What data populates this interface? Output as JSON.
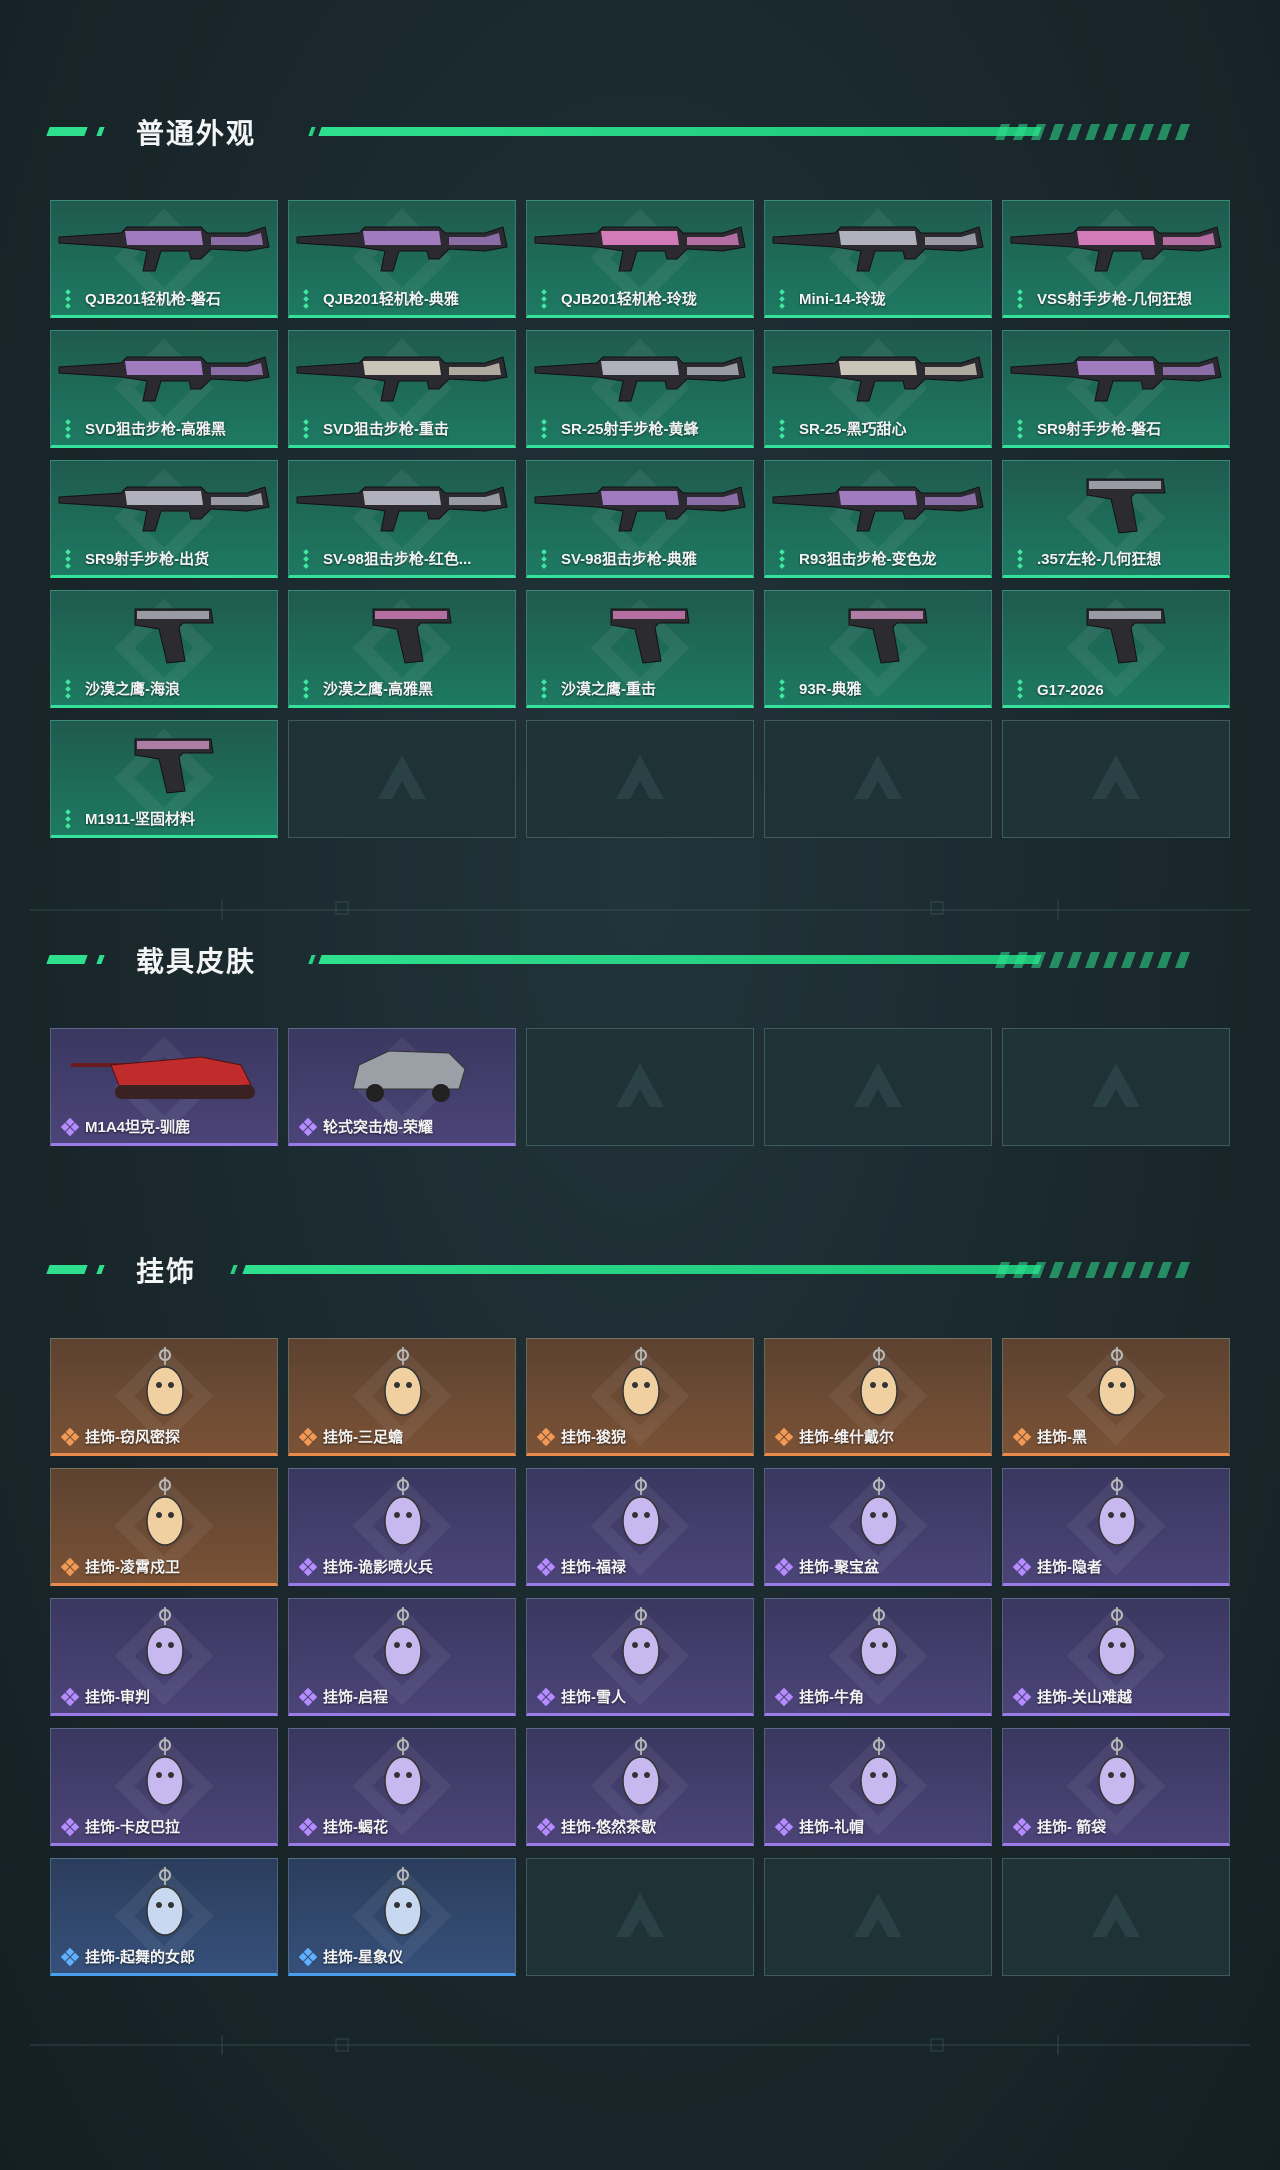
{
  "sections": {
    "skins": {
      "title": "普通外观",
      "items": [
        {
          "label": "QJB201轻机枪-磐石",
          "tier": "green",
          "icon": "light-machine-gun"
        },
        {
          "label": "QJB201轻机枪-典雅",
          "tier": "green",
          "icon": "light-machine-gun"
        },
        {
          "label": "QJB201轻机枪-玲珑",
          "tier": "green",
          "icon": "light-machine-gun"
        },
        {
          "label": "Mini-14-玲珑",
          "tier": "green",
          "icon": "rifle"
        },
        {
          "label": "VSS射手步枪-几何狂想",
          "tier": "green",
          "icon": "marksman-rifle"
        },
        {
          "label": "SVD狙击步枪-高雅黑",
          "tier": "green",
          "icon": "sniper-rifle"
        },
        {
          "label": "SVD狙击步枪-重击",
          "tier": "green",
          "icon": "sniper-rifle"
        },
        {
          "label": "SR-25射手步枪-黄蜂",
          "tier": "green",
          "icon": "marksman-rifle"
        },
        {
          "label": "SR-25-黑巧甜心",
          "tier": "green",
          "icon": "marksman-rifle"
        },
        {
          "label": "SR9射手步枪-磐石",
          "tier": "green",
          "icon": "marksman-rifle"
        },
        {
          "label": "SR9射手步枪-出货",
          "tier": "green",
          "icon": "marksman-rifle"
        },
        {
          "label": "SV-98狙击步枪-红色...",
          "tier": "green",
          "icon": "sniper-rifle"
        },
        {
          "label": "SV-98狙击步枪-典雅",
          "tier": "green",
          "icon": "sniper-rifle"
        },
        {
          "label": "R93狙击步枪-变色龙",
          "tier": "green",
          "icon": "sniper-rifle"
        },
        {
          "label": ".357左轮-几何狂想",
          "tier": "green",
          "icon": "revolver"
        },
        {
          "label": "沙漠之鹰-海浪",
          "tier": "green",
          "icon": "pistol"
        },
        {
          "label": "沙漠之鹰-高雅黑",
          "tier": "green",
          "icon": "pistol"
        },
        {
          "label": "沙漠之鹰-重击",
          "tier": "green",
          "icon": "pistol"
        },
        {
          "label": "93R-典雅",
          "tier": "green",
          "icon": "pistol"
        },
        {
          "label": "G17-2026",
          "tier": "green",
          "icon": "pistol"
        },
        {
          "label": "M1911-坚固材料",
          "tier": "green",
          "icon": "pistol"
        }
      ]
    },
    "vehicles": {
      "title": "载具皮肤",
      "items": [
        {
          "label": "M1A4坦克-驯鹿",
          "tier": "purple",
          "icon": "tank"
        },
        {
          "label": "轮式突击炮-荣耀",
          "tier": "purple",
          "icon": "armored-car"
        }
      ]
    },
    "charms": {
      "title": "挂饰",
      "items": [
        {
          "label": "挂饰-窃风密探",
          "tier": "orange",
          "icon": "charm"
        },
        {
          "label": "挂饰-三足蟾",
          "tier": "orange",
          "icon": "charm"
        },
        {
          "label": "挂饰-狻猊",
          "tier": "orange",
          "icon": "charm"
        },
        {
          "label": "挂饰-维什戴尔",
          "tier": "orange",
          "icon": "charm"
        },
        {
          "label": "挂饰-黑",
          "tier": "orange",
          "icon": "charm"
        },
        {
          "label": "挂饰-凌霄戍卫",
          "tier": "orange",
          "icon": "charm"
        },
        {
          "label": "挂饰-诡影喷火兵",
          "tier": "purple",
          "icon": "charm"
        },
        {
          "label": "挂饰-福禄",
          "tier": "purple",
          "icon": "charm"
        },
        {
          "label": "挂饰-聚宝盆",
          "tier": "purple",
          "icon": "charm"
        },
        {
          "label": "挂饰-隐者",
          "tier": "purple",
          "icon": "charm"
        },
        {
          "label": "挂饰-审判",
          "tier": "purple",
          "icon": "charm"
        },
        {
          "label": "挂饰-启程",
          "tier": "purple",
          "icon": "charm"
        },
        {
          "label": "挂饰-雪人",
          "tier": "purple",
          "icon": "charm"
        },
        {
          "label": "挂饰-牛角",
          "tier": "purple",
          "icon": "charm"
        },
        {
          "label": "挂饰-关山难越",
          "tier": "purple",
          "icon": "charm"
        },
        {
          "label": "挂饰-卡皮巴拉",
          "tier": "purple",
          "icon": "charm"
        },
        {
          "label": "挂饰-蝎花",
          "tier": "purple",
          "icon": "charm"
        },
        {
          "label": "挂饰-悠然茶歇",
          "tier": "purple",
          "icon": "charm"
        },
        {
          "label": "挂饰-礼帽",
          "tier": "purple",
          "icon": "charm"
        },
        {
          "label": "挂饰- 箭袋",
          "tier": "purple",
          "icon": "charm"
        },
        {
          "label": "挂饰-起舞的女郎",
          "tier": "blue",
          "icon": "charm"
        },
        {
          "label": "挂饰-星象仪",
          "tier": "blue",
          "icon": "charm"
        }
      ]
    }
  },
  "colors": {
    "accent": "#2ee08e",
    "green_tier": "#34e29b",
    "purple_tier": "#9b7be8",
    "orange_tier": "#e98a4a",
    "blue_tier": "#4a9ef0"
  }
}
